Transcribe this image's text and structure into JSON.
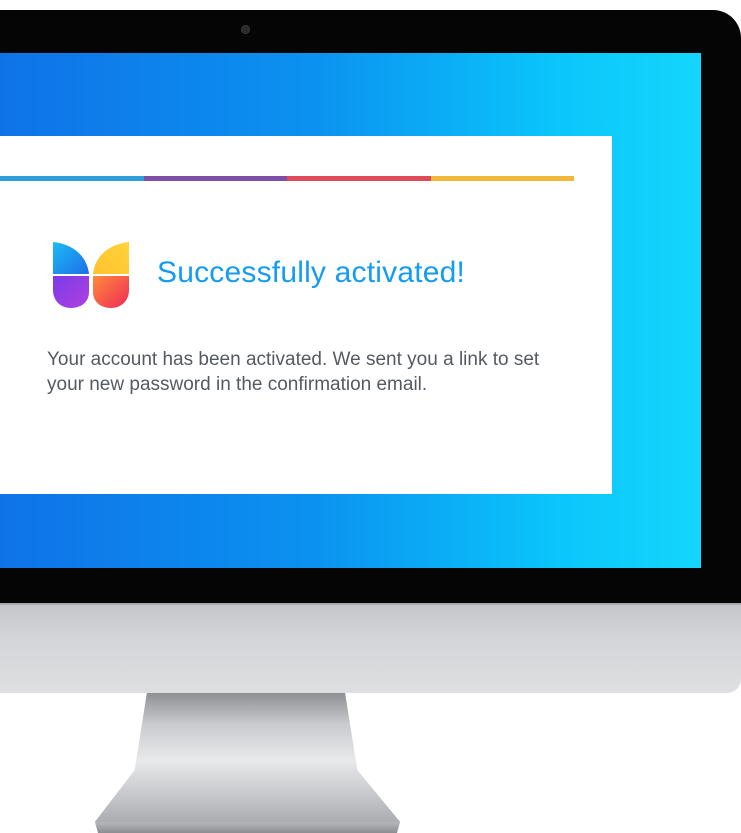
{
  "dialog": {
    "title": "Successfully activated!",
    "message": "Your account has been activated. We sent you a link to set your new password in the confirmation email."
  },
  "brand_colors": {
    "title": "#149cf2",
    "stripe": [
      "#2f9fdc",
      "#7e4fa4",
      "#dd4b5b",
      "#f0b739"
    ],
    "screen_gradient": [
      "#0f73e8",
      "#14d6fd"
    ]
  },
  "icons": {
    "logo": "butterfly-logo-icon",
    "camera": "camera-dot"
  }
}
